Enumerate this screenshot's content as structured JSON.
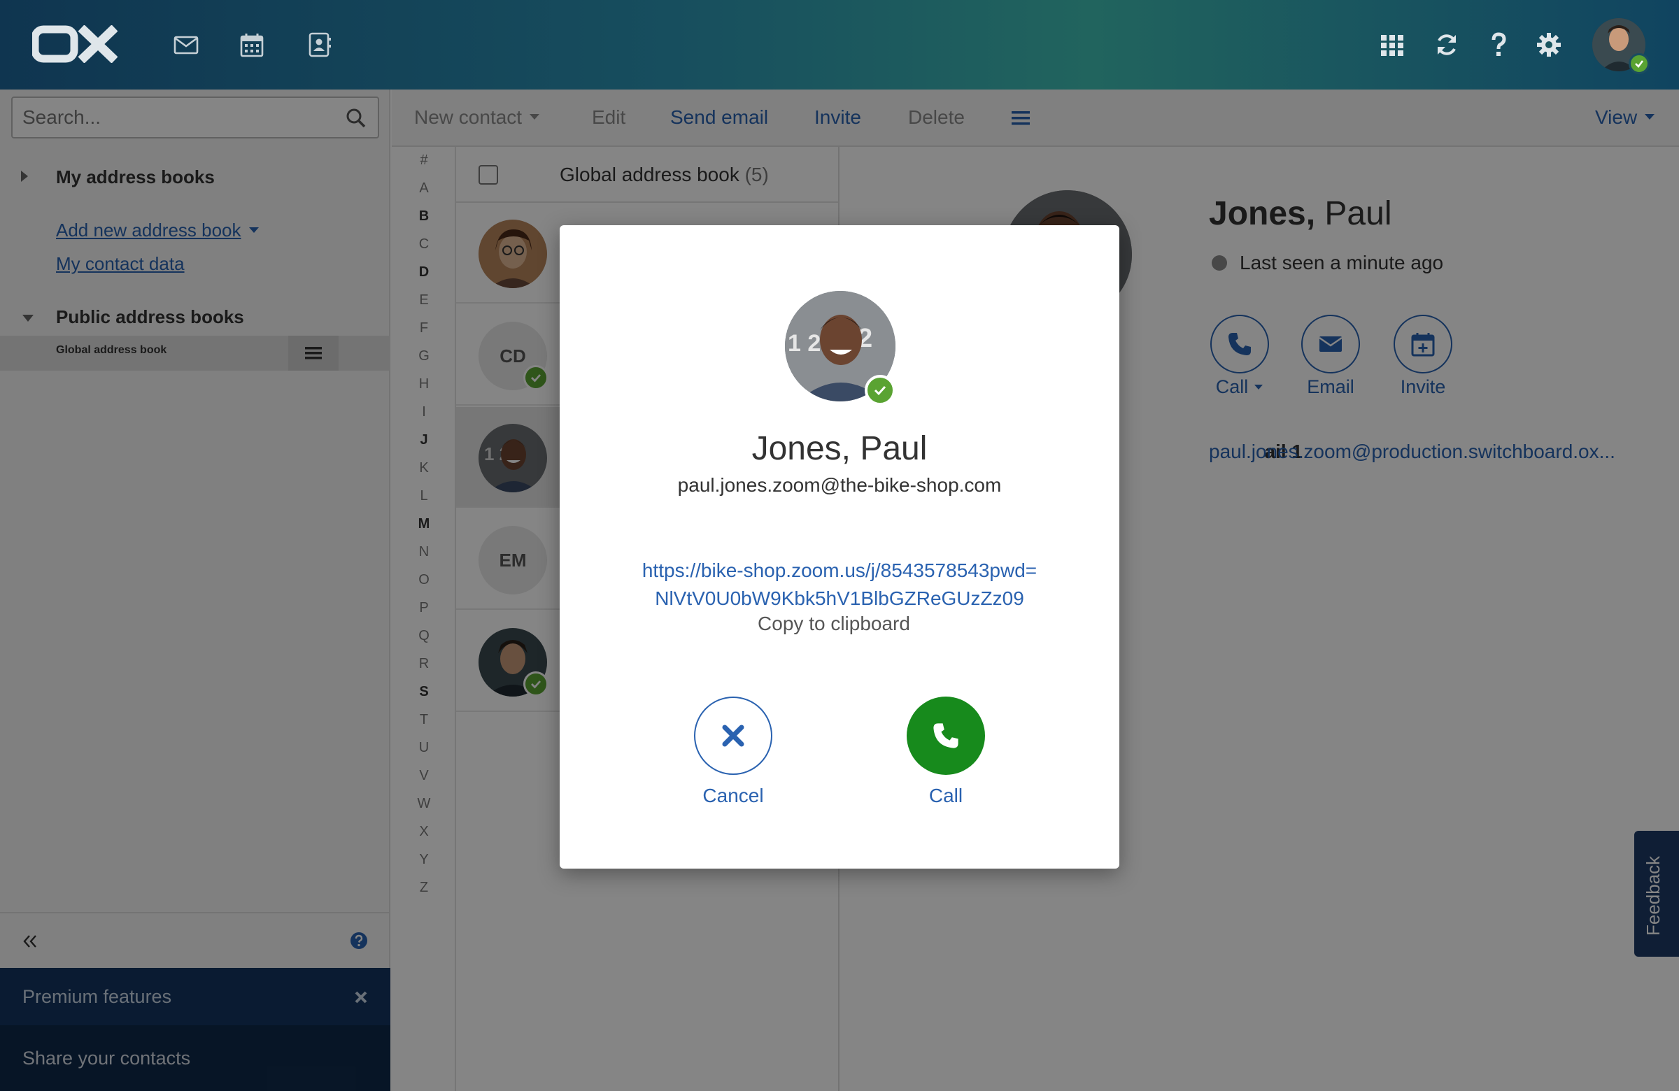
{
  "app": {
    "logo_text": "OX",
    "colors": {
      "accent": "#2a62b0",
      "status_online": "#5aa332",
      "call_green": "#178a1c",
      "topbar": "#174e5e",
      "premium_bg": "#143561"
    }
  },
  "topbar": {
    "apps": [
      "mail-icon",
      "calendar-icon",
      "address-book-icon"
    ],
    "right_icons": [
      "apps-grid-icon",
      "refresh-icon",
      "help-icon",
      "gear-icon"
    ]
  },
  "sidebar": {
    "search_placeholder": "Search...",
    "my_address_books": "My address books",
    "add_new_address_book": "Add new address book",
    "my_contact_data": "My contact data",
    "public_address_books": "Public address books",
    "global_address_book": "Global address book",
    "premium_title": "Premium features",
    "premium_item": "Share your contacts"
  },
  "toolbar": {
    "new_contact": "New contact",
    "edit": "Edit",
    "send_email": "Send email",
    "invite": "Invite",
    "delete": "Delete",
    "view": "View"
  },
  "alphabet": [
    "#",
    "A",
    "B",
    "C",
    "D",
    "E",
    "F",
    "G",
    "H",
    "I",
    "J",
    "K",
    "L",
    "M",
    "N",
    "O",
    "P",
    "Q",
    "R",
    "S",
    "T",
    "U",
    "V",
    "W",
    "X",
    "Y",
    "Z"
  ],
  "alphabet_bold": [
    "B",
    "D",
    "J",
    "M",
    "S"
  ],
  "list": {
    "title": "Global address book",
    "count": "(5)",
    "items": [
      {
        "initials": "",
        "kind": "photo-woman"
      },
      {
        "initials": "CD",
        "kind": "initials"
      },
      {
        "initials": "",
        "kind": "photo-paul"
      },
      {
        "initials": "EM",
        "kind": "initials"
      },
      {
        "initials": "",
        "kind": "photo-man"
      }
    ]
  },
  "detail": {
    "last_name": "Jones,",
    "first_name": "Paul",
    "status": "Last seen a minute ago",
    "actions": {
      "call": "Call",
      "email": "Email",
      "invite": "Invite"
    },
    "email_label": "ail 1",
    "email_value": "paul.jones.zoom@production.switchboard.ox..."
  },
  "feedback": "Feedback",
  "modal": {
    "name": "Jones, Paul",
    "email": "paul.jones.zoom@the-bike-shop.com",
    "link_line1": "https://bike-shop.zoom.us/j/8543578543pwd=",
    "link_line2": "NlVtV0U0bW9Kbk5hV1BlbGZReGUzZz09",
    "copy": "Copy to clipboard",
    "cancel": "Cancel",
    "call": "Call"
  }
}
